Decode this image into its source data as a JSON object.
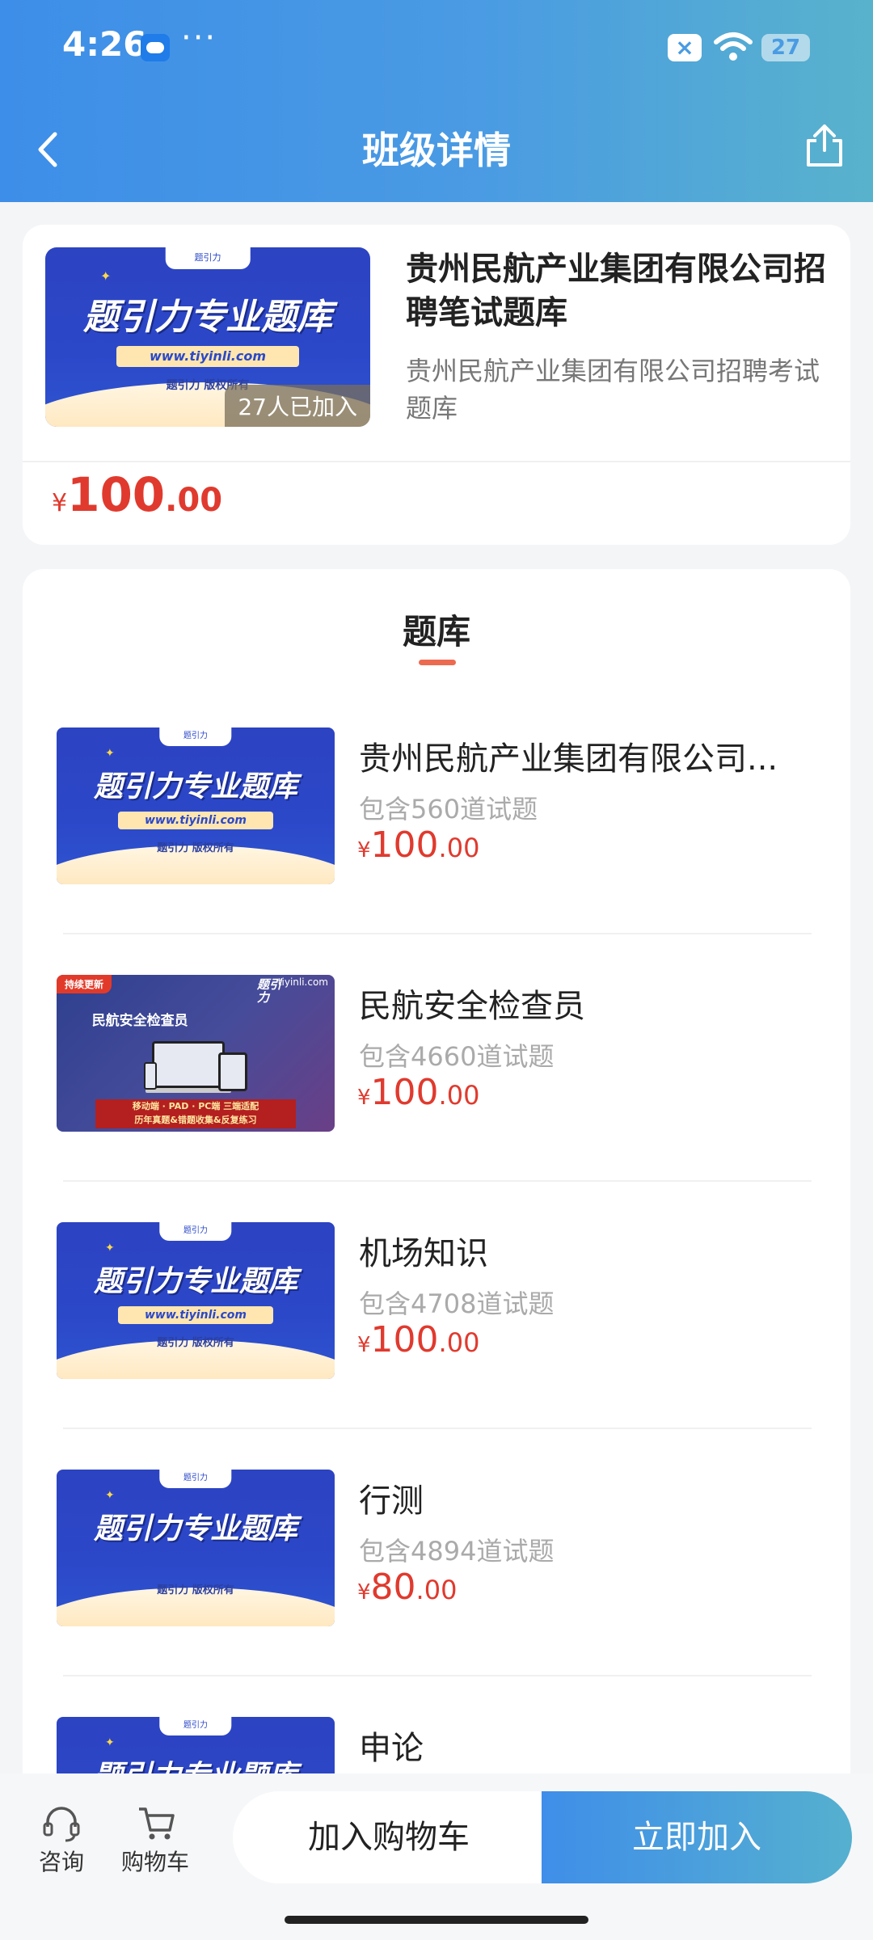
{
  "status_bar": {
    "time": "4:26",
    "dots": "···",
    "battery": "27"
  },
  "header": {
    "title": "班级详情"
  },
  "course": {
    "name": "贵州民航产业集团有限公司招聘笔试题库",
    "description": "贵州民航产业集团有限公司招聘考试题库",
    "joined": "27人已加入",
    "price": {
      "currency": "¥",
      "integer": "100",
      "decimal": ".00"
    },
    "thumb": {
      "brand": "题引力",
      "main": "题引力专业题库",
      "url": "www.tiyinli.com",
      "copyright": "题引力 版权所有"
    }
  },
  "section": {
    "title": "题库"
  },
  "items": [
    {
      "name": "贵州民航产业集团有限公司...",
      "count": "包含560道试题",
      "currency": "¥",
      "price_int": "100",
      "price_dec": ".00"
    },
    {
      "name": "民航安全检查员",
      "count": "包含4660道试题",
      "currency": "¥",
      "price_int": "100",
      "price_dec": ".00"
    },
    {
      "name": "机场知识",
      "count": "包含4708道试题",
      "currency": "¥",
      "price_int": "100",
      "price_dec": ".00"
    },
    {
      "name": "行测",
      "count": "包含4894道试题",
      "currency": "¥",
      "price_int": "80",
      "price_dec": ".00"
    },
    {
      "name": "申论",
      "count": "",
      "currency": "",
      "price_int": "",
      "price_dec": ""
    }
  ],
  "promo_thumb": {
    "badge": "持续更新",
    "label": "民航安全检查员",
    "brand": "tiyinli.com",
    "logo": "题引力",
    "strip_line1": "移动端 · PAD · PC端 三端适配",
    "strip_line2": "历年真题&错题收集&反复练习"
  },
  "bottom_bar": {
    "consult": "咨询",
    "cart": "购物车",
    "add_cart": "加入购物车",
    "join_now": "立即加入"
  },
  "colors": {
    "header_start": "#3d8ee8",
    "header_end": "#58b2cc",
    "price": "#e03a2e",
    "accent_line": "#ec6b50"
  }
}
